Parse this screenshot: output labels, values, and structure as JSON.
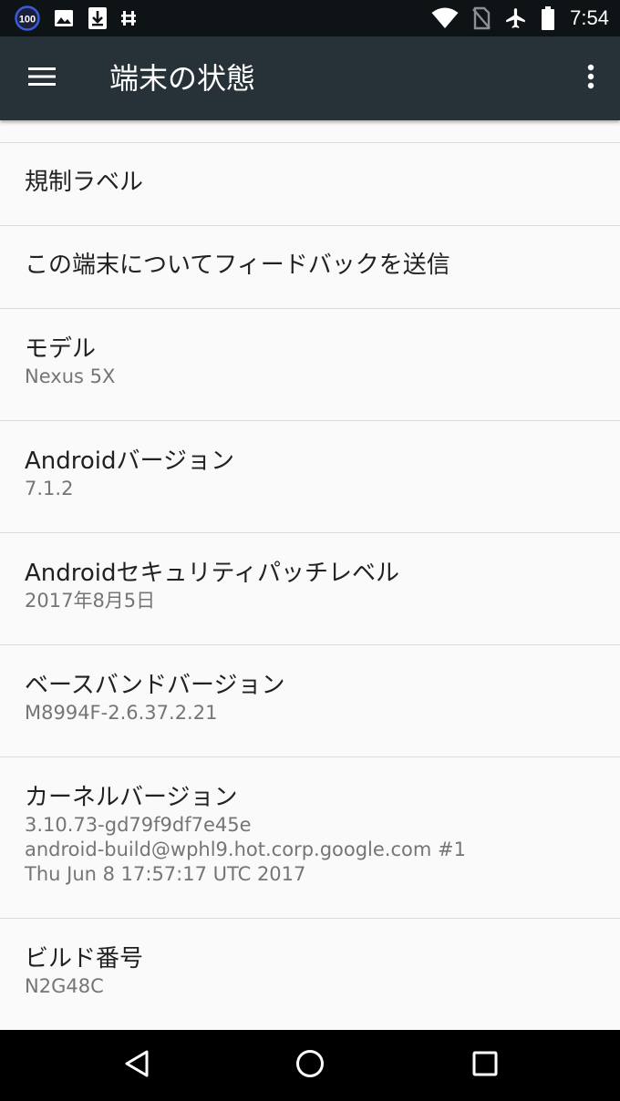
{
  "status_bar": {
    "battery_saver_badge": "100",
    "time": "7:54",
    "left_icons": [
      "battery-100-badge-icon",
      "image-icon",
      "download-icon",
      "usb-debug-icon"
    ],
    "right_icons": [
      "wifi-icon",
      "no-sim-icon",
      "airplane-icon",
      "battery-icon"
    ]
  },
  "app_bar": {
    "title": "端末の状態",
    "background": "#263238"
  },
  "items": [
    {
      "title": "規制ラベル"
    },
    {
      "title": "この端末についてフィードバックを送信"
    },
    {
      "title": "モデル",
      "summary": "Nexus 5X"
    },
    {
      "title": "Androidバージョン",
      "summary": "7.1.2"
    },
    {
      "title": "Androidセキュリティパッチレベル",
      "summary": "2017年8月5日"
    },
    {
      "title": "ベースバンドバージョン",
      "summary": "M8994F-2.6.37.2.21"
    },
    {
      "title": "カーネルバージョン",
      "summary_lines": [
        "3.10.73-gd79f9df7e45e",
        "android-build@wphl9.hot.corp.google.com #1",
        "Thu Jun 8 17:57:17 UTC 2017"
      ]
    },
    {
      "title": "ビルド番号",
      "summary": "N2G48C"
    }
  ],
  "nav_bar": {
    "buttons": [
      "back-icon",
      "home-icon",
      "recents-icon"
    ]
  }
}
